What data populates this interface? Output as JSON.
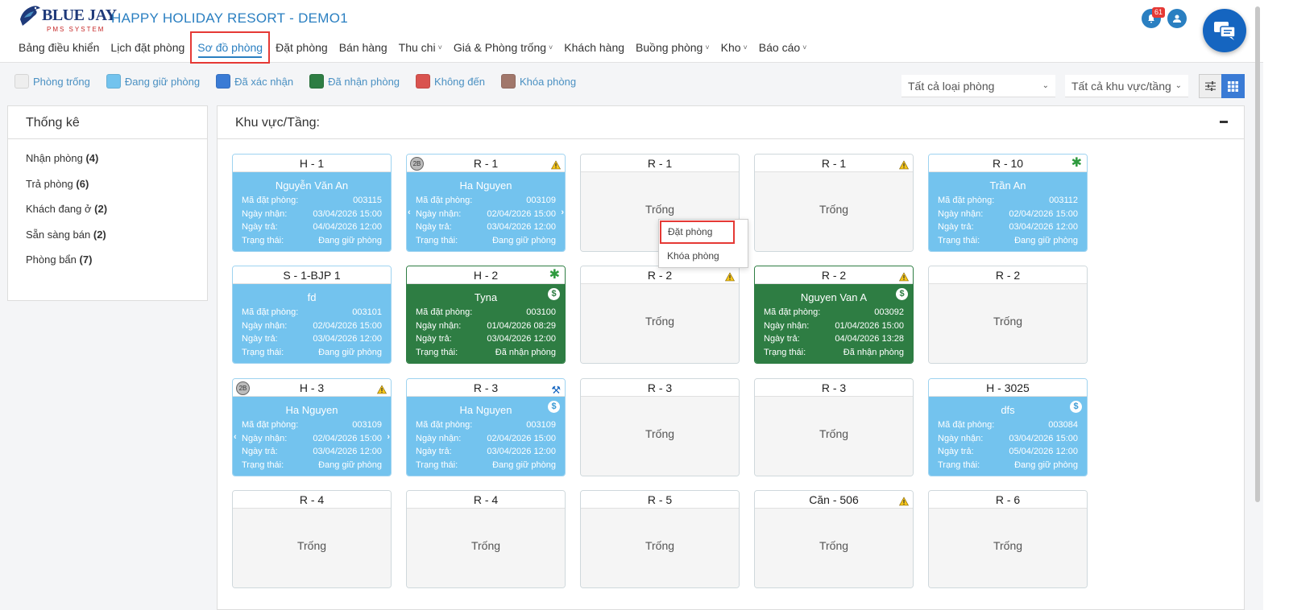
{
  "app": {
    "brand": "BLUE JAY",
    "brand_sub": "PMS SYSTEM",
    "resort_name": "HAPPY HOLIDAY RESORT - DEMO1",
    "notification_count": "61"
  },
  "nav": [
    {
      "label": "Bảng điều khiển",
      "dropdown": false
    },
    {
      "label": "Lịch đặt phòng",
      "dropdown": false
    },
    {
      "label": "Sơ đồ phòng",
      "dropdown": false,
      "active": true
    },
    {
      "label": "Đặt phòng",
      "dropdown": false
    },
    {
      "label": "Bán hàng",
      "dropdown": false
    },
    {
      "label": "Thu chi",
      "dropdown": true
    },
    {
      "label": "Giá & Phòng trống",
      "dropdown": true
    },
    {
      "label": "Khách hàng",
      "dropdown": false
    },
    {
      "label": "Buồng phòng",
      "dropdown": true
    },
    {
      "label": "Kho",
      "dropdown": true
    },
    {
      "label": "Báo cáo",
      "dropdown": true
    }
  ],
  "legend": [
    {
      "label": "Phòng trống",
      "color": "#eeeeee"
    },
    {
      "label": "Đang giữ phòng",
      "color": "#73c3ee"
    },
    {
      "label": "Đã xác nhận",
      "color": "#3a7bd5"
    },
    {
      "label": "Đã nhận phòng",
      "color": "#2e7d43"
    },
    {
      "label": "Không đến",
      "color": "#d9534f"
    },
    {
      "label": "Khóa phòng",
      "color": "#a1776b"
    }
  ],
  "filters": {
    "room_type": "Tất cả loại phòng",
    "area": "Tất cả khu vực/tầng"
  },
  "stats": {
    "title": "Thống kê",
    "items": [
      {
        "label": "Nhận phòng",
        "count": "(4)"
      },
      {
        "label": "Trả phòng",
        "count": "(6)"
      },
      {
        "label": "Khách đang ở",
        "count": "(2)"
      },
      {
        "label": "Sẵn sàng bán",
        "count": "(2)"
      },
      {
        "label": "Phòng bẩn",
        "count": "(7)"
      }
    ]
  },
  "main": {
    "title": "Khu vực/Tầng:",
    "labels": {
      "code": "Mã đặt phòng:",
      "checkin": "Ngày nhận:",
      "checkout": "Ngày trả:",
      "status": "Trạng thái:",
      "empty": "Trống"
    }
  },
  "rooms": [
    {
      "name": "H - 1",
      "state": "blue",
      "guest": "Nguyễn Văn An",
      "code": "003115",
      "checkin": "03/04/2026 15:00",
      "checkout": "04/04/2026 12:00",
      "status": "Đang giữ phòng"
    },
    {
      "name": "R - 1",
      "state": "blue",
      "tag": "2B",
      "warn": true,
      "arrows": true,
      "guest": "Ha Nguyen",
      "code": "003109",
      "checkin": "02/04/2026 15:00",
      "checkout": "03/04/2026 12:00",
      "status": "Đang giữ phòng"
    },
    {
      "name": "R - 1",
      "state": "empty"
    },
    {
      "name": "R - 1",
      "state": "empty",
      "warn": true
    },
    {
      "name": "R - 10",
      "state": "blue",
      "asterisk": true,
      "guest": "Trần An",
      "code": "003112",
      "checkin": "02/04/2026 15:00",
      "checkout": "03/04/2026 12:00",
      "status": "Đang giữ phòng"
    },
    {
      "name": "S - 1-BJP 1",
      "state": "blue",
      "guest": "fd",
      "code": "003101",
      "checkin": "02/04/2026 15:00",
      "checkout": "03/04/2026 12:00",
      "status": "Đang giữ phòng"
    },
    {
      "name": "H - 2",
      "state": "green",
      "asterisk": true,
      "dollar": true,
      "guest": "Tyna",
      "code": "003100",
      "checkin": "01/04/2026 08:29",
      "checkout": "03/04/2026 12:00",
      "status": "Đã nhận phòng"
    },
    {
      "name": "R - 2",
      "state": "empty",
      "warn": true
    },
    {
      "name": "R - 2",
      "state": "green",
      "warn": true,
      "dollar": true,
      "guest": "Nguyen Van A",
      "code": "003092",
      "checkin": "01/04/2026 15:00",
      "checkout": "04/04/2026 13:28",
      "status": "Đã nhận phòng"
    },
    {
      "name": "R - 2",
      "state": "empty"
    },
    {
      "name": "H - 3",
      "state": "blue",
      "tag": "2B",
      "warn": true,
      "arrows": true,
      "guest": "Ha Nguyen",
      "code": "003109",
      "checkin": "02/04/2026 15:00",
      "checkout": "03/04/2026 12:00",
      "status": "Đang giữ phòng"
    },
    {
      "name": "R - 3",
      "state": "blue",
      "tool": true,
      "dollar": true,
      "guest": "Ha Nguyen",
      "code": "003109",
      "checkin": "02/04/2026 15:00",
      "checkout": "03/04/2026 12:00",
      "status": "Đang giữ phòng"
    },
    {
      "name": "R - 3",
      "state": "empty"
    },
    {
      "name": "R - 3",
      "state": "empty"
    },
    {
      "name": "H - 3025",
      "state": "blue",
      "dollar": true,
      "guest": "dfs",
      "code": "003084",
      "checkin": "03/04/2026 15:00",
      "checkout": "05/04/2026 12:00",
      "status": "Đang giữ phòng"
    },
    {
      "name": "R - 4",
      "state": "empty"
    },
    {
      "name": "R - 4",
      "state": "empty"
    },
    {
      "name": "R - 5",
      "state": "empty"
    },
    {
      "name": "Căn - 506",
      "state": "empty",
      "warn": true
    },
    {
      "name": "R - 6",
      "state": "empty"
    }
  ],
  "context_menu": {
    "book": "Đặt phòng",
    "lock": "Khóa phòng"
  }
}
